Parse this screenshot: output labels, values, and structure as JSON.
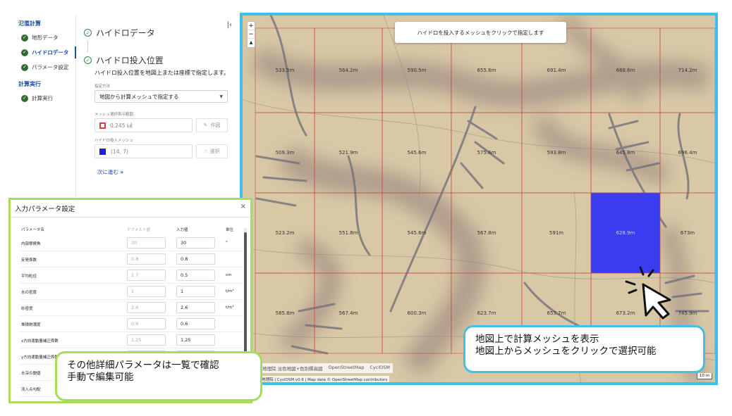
{
  "steps": {
    "groups": [
      {
        "title": "氾濫計算",
        "items": [
          {
            "label": "地形データ",
            "active": false
          },
          {
            "label": "ハイドロデータ",
            "active": true
          },
          {
            "label": "パラメータ設定",
            "active": false
          }
        ]
      },
      {
        "title": "計算実行",
        "items": [
          {
            "label": "計算実行",
            "active": false
          }
        ]
      }
    ]
  },
  "form": {
    "collapse_icon": "collapse-left-icon",
    "step1_title": "ハイドロデータ",
    "step2_title": "ハイドロ投入位置",
    "description": "ハイドロ投入位置を地図上または座標で指定します。",
    "method_label": "指定方法",
    "method_value": "地図から計算メッシュで指定する",
    "range_label": "メッシュ選択表示範囲",
    "range_value": "0.245 ㎢",
    "range_button": "作図",
    "mesh_label": "ハイドロ投入メッシュ",
    "mesh_value": "(14, 7)",
    "mesh_button": "選択",
    "next_label": "次に進む"
  },
  "map": {
    "hint": "ハイドロを投入するメッシュをクリックで指定します",
    "zoom_in": "+",
    "zoom_out": "−",
    "compass": "▲",
    "highlight_color": "#3b3bef",
    "grid_color": "#c8483e",
    "selected_cell": {
      "row": 2,
      "col": 5,
      "label": "628.9m"
    },
    "cells": [
      [
        "533.5m",
        "564.2m",
        "590.5m",
        "655.6m",
        "691.4m",
        "688.6m",
        "714.2m"
      ],
      [
        "509.3m",
        "521.9m",
        "545.6m",
        "575.6m",
        "593.8m",
        "645.8m",
        "696.4m"
      ],
      [
        "523.2m",
        "551.8m",
        "545.6m",
        "567.8m",
        "591m",
        "628.9m",
        "673m"
      ],
      [
        "585.8m",
        "567.4m",
        "600.3m",
        "623.7m",
        "653.7m",
        "673.2m",
        "745.9m"
      ]
    ],
    "attribution_layers": [
      "地理院 淡色地図+色別標高図",
      "OpenStreetMap",
      "CyclOSM"
    ],
    "attribution_text": "地理院 | CyclOSM v0.6 | Map data © OpenStreetMap contributors",
    "scale": "10 m"
  },
  "callouts": {
    "map": [
      "地図上で計算メッシュを表示",
      "地図上からメッシュをクリックで選択可能"
    ],
    "params": [
      "その他詳細パラメータは一覧で確認",
      "手動で編集可能"
    ]
  },
  "dialog": {
    "title": "入力パラメータ設定",
    "close": "×",
    "headers": {
      "name": "パラメータ名",
      "default": "デフォルト値",
      "input": "入力値",
      "unit": "単位"
    },
    "rows": [
      {
        "name": "内部摩擦角",
        "default": "30",
        "input": "30",
        "unit": "°"
      },
      {
        "name": "反発係数",
        "default": "0.8",
        "input": "0.8",
        "unit": ""
      },
      {
        "name": "平均粒径",
        "default": "2.7",
        "input": "0.5",
        "unit": "cm"
      },
      {
        "name": "水の密度",
        "default": "1",
        "input": "1",
        "unit": "t/m³"
      },
      {
        "name": "砂密度",
        "default": "2.6",
        "input": "2.6",
        "unit": "t/m³"
      },
      {
        "name": "堆積物濃度",
        "default": "0.6",
        "input": "0.6",
        "unit": ""
      },
      {
        "name": "x方向運動量補正係数",
        "default": "1.25",
        "input": "1.25",
        "unit": ""
      },
      {
        "name": "y方向運動量補正係数",
        "default": "",
        "input": "",
        "unit": ""
      },
      {
        "name": "水深の閾値",
        "default": "",
        "input": "",
        "unit": ""
      },
      {
        "name": "流入点勾配",
        "default": "",
        "input": "",
        "unit": ""
      }
    ]
  }
}
